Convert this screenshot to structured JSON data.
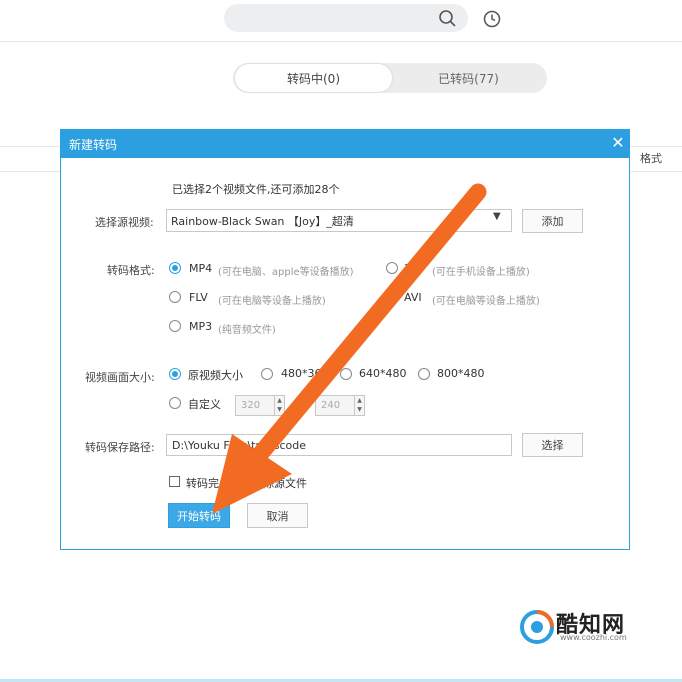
{
  "tabs": [
    {
      "label": "转码中(0)",
      "active": true
    },
    {
      "label": "已转码(77)",
      "active": false
    }
  ],
  "table": {
    "format_header": "格式"
  },
  "dialog": {
    "title": "新建转码",
    "info_text": "已选择2个视频文件,还可添加28个",
    "source_label": "选择源视频:",
    "source_value": "Rainbow-Black Swan 【Joy】_超清",
    "add_button": "添加",
    "format_label": "转码格式:",
    "formats": [
      {
        "name": "MP4",
        "hint": "(可在电脑、apple等设备播放)",
        "checked": true
      },
      {
        "name": "3GP",
        "hint": "(可在手机设备上播放)",
        "checked": false
      },
      {
        "name": "FLV",
        "hint": "(可在电脑等设备上播放)",
        "checked": false
      },
      {
        "name": "AVI",
        "hint": "(可在电脑等设备上播放)",
        "checked": false
      },
      {
        "name": "MP3",
        "hint": "(纯音频文件)",
        "checked": false
      }
    ],
    "size_label": "视频画面大小:",
    "sizes": [
      {
        "name": "原视频大小",
        "checked": true
      },
      {
        "name": "480*360",
        "checked": false
      },
      {
        "name": "640*480",
        "checked": false
      },
      {
        "name": "800*480",
        "checked": false
      }
    ],
    "custom_label": "自定义",
    "custom_width": "320",
    "custom_height": "240",
    "path_label": "转码保存路径:",
    "path_value": "D:\\Youku Files\\transcode",
    "browse_button": "选择",
    "delete_checkbox_label": "转码完成后，删除源文件",
    "start_button": "开始转码",
    "cancel_button": "取消"
  },
  "annotation": {
    "arrow_color": "#f26b22"
  },
  "watermark": {
    "title": "酷知网",
    "url": "www.coozhi.com"
  },
  "colors": {
    "accent": "#2b9fe0"
  }
}
